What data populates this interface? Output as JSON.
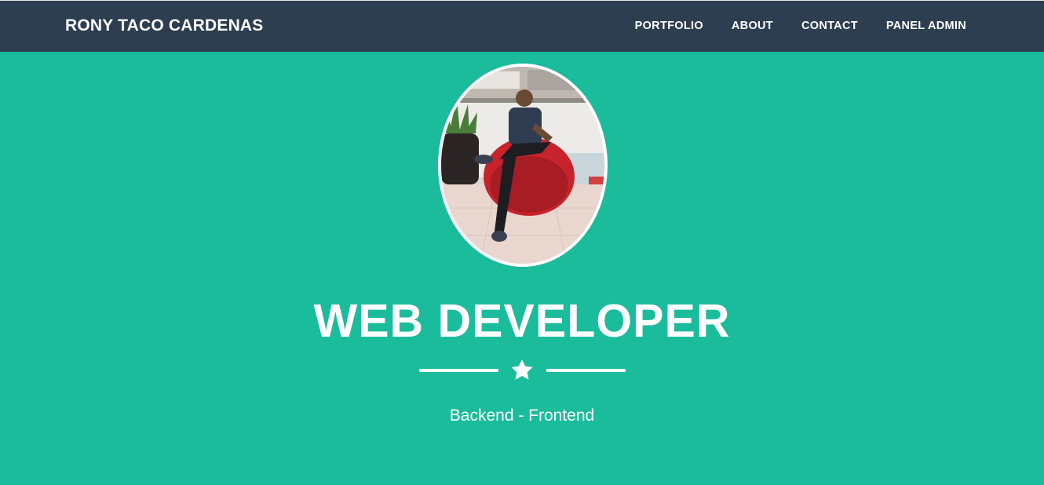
{
  "navbar": {
    "brand": "RONY TACO CARDENAS",
    "links": [
      {
        "label": "PORTFOLIO"
      },
      {
        "label": "ABOUT"
      },
      {
        "label": "CONTACT"
      },
      {
        "label": "PANEL ADMIN"
      }
    ]
  },
  "masthead": {
    "heading": "WEB DEVELOPER",
    "divider_icon": "star-icon",
    "subheading": "Backend - Frontend"
  },
  "colors": {
    "navbar_bg": "#2c3e50",
    "masthead_bg": "#1abc9c",
    "text": "#ffffff"
  }
}
